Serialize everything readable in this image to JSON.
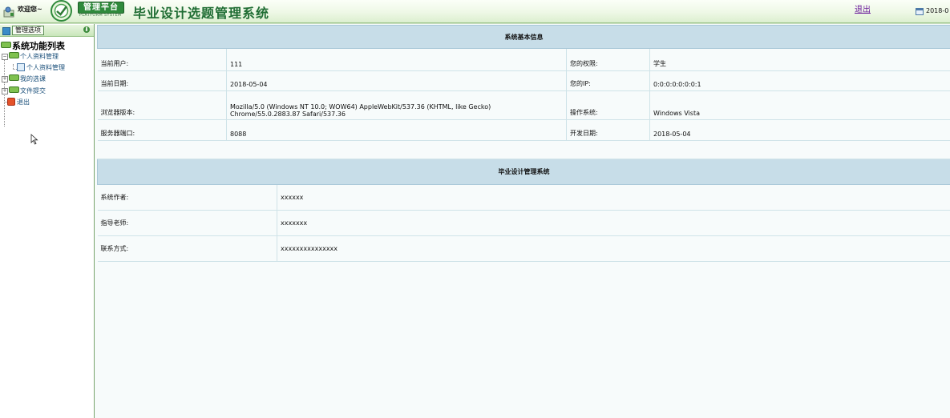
{
  "header": {
    "welcome": "欢迎您~",
    "platform_badge": "管理平台",
    "platform_sub": "PLATFORM SYSTEM",
    "system_title": "毕业设计选题管理系统",
    "logout": "退出",
    "date": "2018-0"
  },
  "sidebar": {
    "panel_label": "管理选项",
    "toggle": "⬇",
    "tree_title": "系统功能列表",
    "items": [
      {
        "label": "个人资料管理",
        "type": "folder"
      },
      {
        "label": "个人资料管理",
        "type": "leaf"
      },
      {
        "label": "我的选课",
        "type": "folder"
      },
      {
        "label": "文件提交",
        "type": "folder"
      },
      {
        "label": "退出",
        "type": "leaf"
      }
    ]
  },
  "system_info": {
    "heading": "系统基本信息",
    "rows": [
      {
        "label": "当前用户:",
        "value": "111",
        "label2": "您的权限:",
        "value2": "学生"
      },
      {
        "label": "当前日期:",
        "value": "2018-05-04",
        "label2": "您的IP:",
        "value2": "0:0:0:0:0:0:0:1"
      },
      {
        "label": "浏览器版本:",
        "value": "Mozilla/5.0 (Windows NT 10.0; WOW64) AppleWebKit/537.36 (KHTML, like Gecko) Chrome/55.0.2883.87 Safari/537.36",
        "label2": "操作系统:",
        "value2": "Windows Vista"
      },
      {
        "label": "服务器端口:",
        "value": "8088",
        "label2": "开发日期:",
        "value2": "2018-05-04"
      }
    ]
  },
  "dev_info": {
    "heading": "毕业设计管理系统",
    "rows": [
      {
        "label": "系统作者:",
        "value": "xxxxxx"
      },
      {
        "label": "指导老师:",
        "value": "xxxxxxx"
      },
      {
        "label": "联系方式:",
        "value": "xxxxxxxxxxxxxxx"
      }
    ]
  },
  "colors": {
    "header_green": "#1f6d33",
    "section_head_bg": "#c7dde8",
    "link_purple": "#6a1b9a"
  }
}
